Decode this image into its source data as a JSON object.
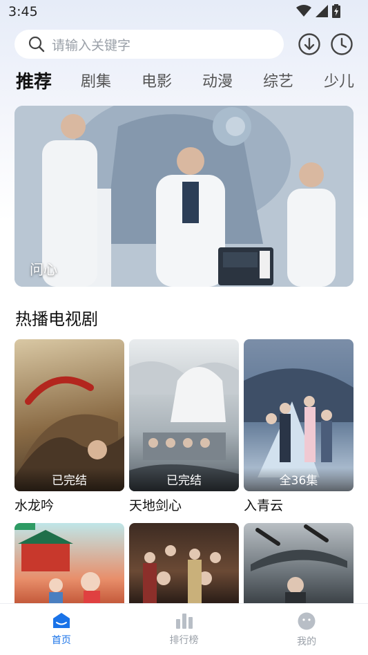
{
  "status_bar": {
    "time": "3:45",
    "icons": [
      "wifi-icon",
      "signal-icon",
      "battery-icon"
    ]
  },
  "search": {
    "placeholder": "请输入关键字",
    "icons": [
      "search-icon",
      "download-icon",
      "history-icon"
    ]
  },
  "tabs": [
    {
      "label": "推荐",
      "active": true
    },
    {
      "label": "剧集"
    },
    {
      "label": "电影"
    },
    {
      "label": "动漫"
    },
    {
      "label": "综艺"
    },
    {
      "label": "少儿"
    }
  ],
  "banner": {
    "caption": "问心"
  },
  "section": {
    "title": "热播电视剧"
  },
  "dramas": [
    {
      "title": "水龙吟",
      "badge": "已完结"
    },
    {
      "title": "天地剑心",
      "badge": "已完结"
    },
    {
      "title": "入青云",
      "badge": "全36集"
    },
    {
      "title": "",
      "badge": ""
    },
    {
      "title": "",
      "badge": ""
    },
    {
      "title": "",
      "badge": ""
    }
  ],
  "bottom_nav": [
    {
      "label": "首页",
      "icon": "home-icon",
      "active": true
    },
    {
      "label": "排行榜",
      "icon": "ranking-icon"
    },
    {
      "label": "我的",
      "icon": "profile-icon"
    }
  ],
  "colors": {
    "accent": "#1a73e8",
    "inactive": "#9aa0a8"
  }
}
